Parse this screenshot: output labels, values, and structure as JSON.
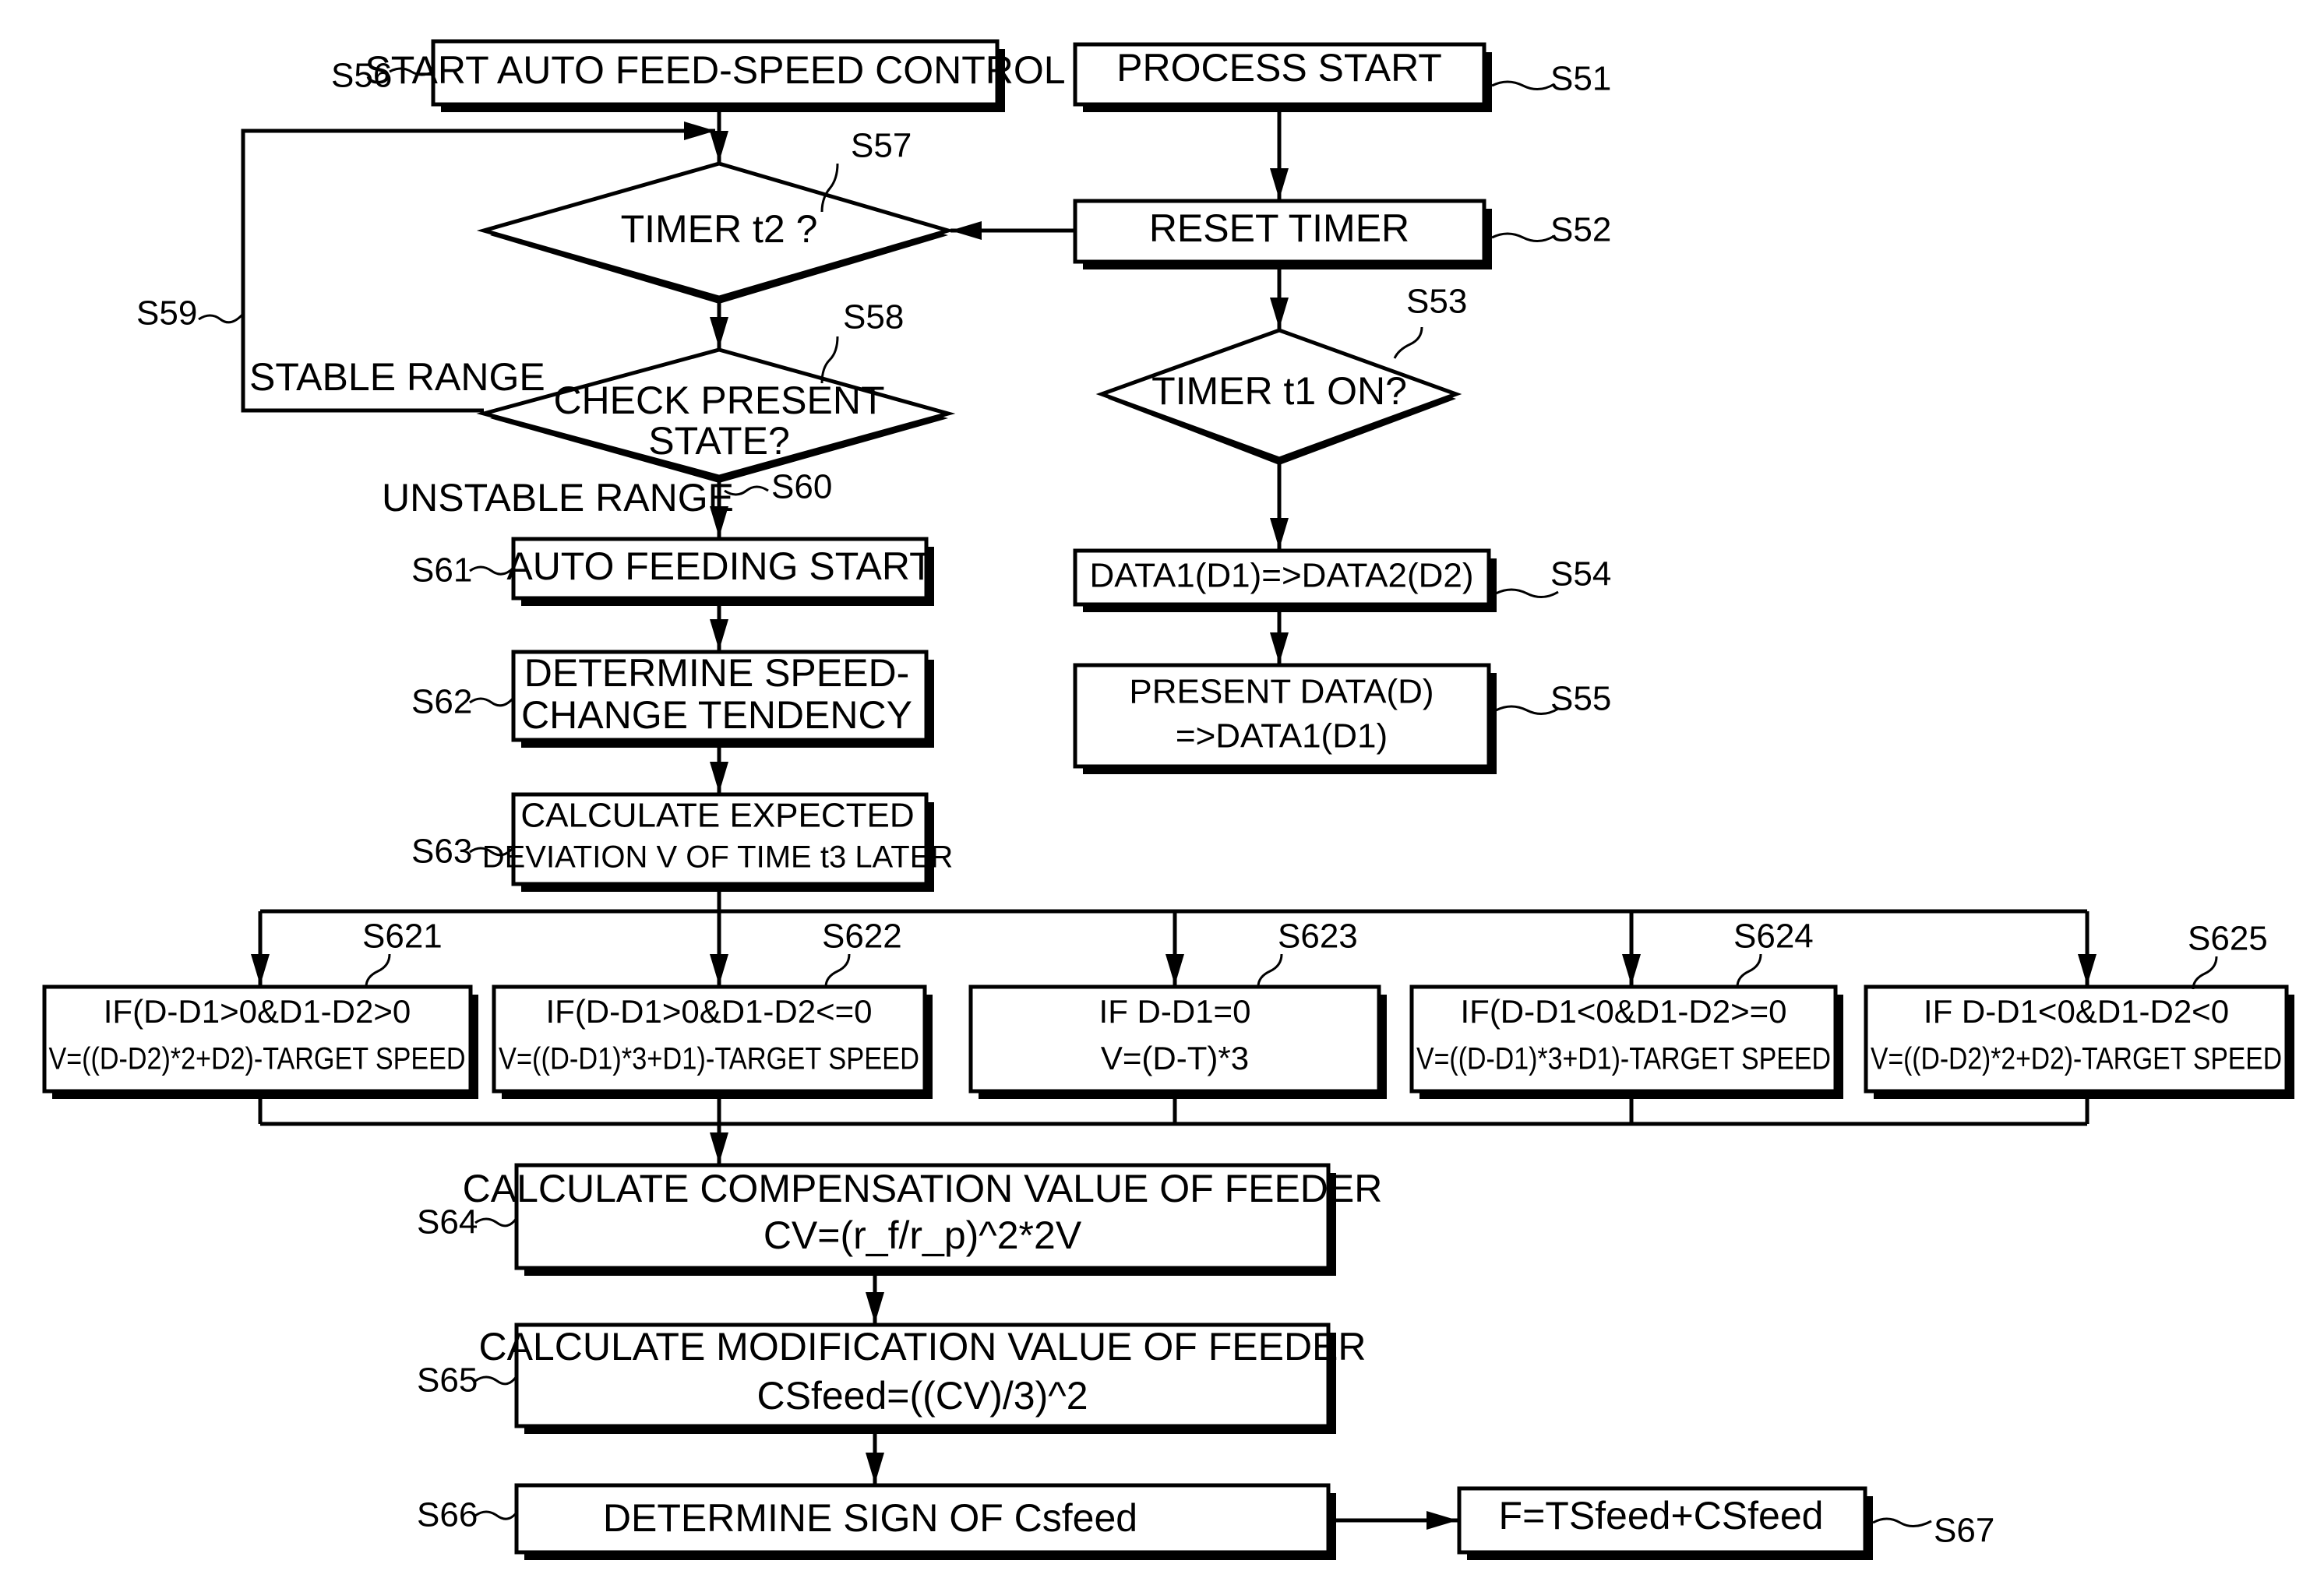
{
  "diagram": {
    "type": "flowchart",
    "left_flow": {
      "s56": {
        "id": "S56",
        "text": "START AUTO FEED-SPEED CONTROL"
      },
      "s57": {
        "id": "S57",
        "text": "TIMER t2 ?"
      },
      "s58": {
        "id": "S58",
        "line1": "CHECK PRESENT",
        "line2": "STATE?"
      },
      "s59": {
        "id": "S59",
        "label": "STABLE RANGE"
      },
      "s60": {
        "id": "S60",
        "label": "UNSTABLE RANGE"
      },
      "s61": {
        "id": "S61",
        "text": "AUTO FEEDING START"
      },
      "s62": {
        "id": "S62",
        "line1": "DETERMINE SPEED-",
        "line2": "CHANGE TENDENCY"
      },
      "s63": {
        "id": "S63",
        "line1": "CALCULATE EXPECTED",
        "line2": "DEVIATION V OF TIME t3 LATER"
      }
    },
    "right_flow": {
      "s51": {
        "id": "S51",
        "text": "PROCESS START"
      },
      "s52": {
        "id": "S52",
        "text": "RESET TIMER"
      },
      "s53": {
        "id": "S53",
        "text": "TIMER t1 ON?"
      },
      "s54": {
        "id": "S54",
        "text": "DATA1(D1)=>DATA2(D2)"
      },
      "s55": {
        "id": "S55",
        "line1": "PRESENT DATA(D)",
        "line2": "=>DATA1(D1)"
      }
    },
    "branches": [
      {
        "id": "S621",
        "line1": "IF(D-D1>0&D1-D2>0",
        "line2": "V=((D-D2)*2+D2)-TARGET SPEED"
      },
      {
        "id": "S622",
        "line1": "IF(D-D1>0&D1-D2<=0",
        "line2": "V=((D-D1)*3+D1)-TARGET SPEED"
      },
      {
        "id": "S623",
        "line1": "IF D-D1=0",
        "line2": "V=(D-T)*3"
      },
      {
        "id": "S624",
        "line1": "IF(D-D1<0&D1-D2>=0",
        "line2": "V=((D-D1)*3+D1)-TARGET SPEED"
      },
      {
        "id": "S625",
        "line1": "IF D-D1<0&D1-D2<0",
        "line2": "V=((D-D2)*2+D2)-TARGET SPEED"
      }
    ],
    "bottom_flow": {
      "s64": {
        "id": "S64",
        "line1": "CALCULATE COMPENSATION VALUE OF FEEDER",
        "line2": "CV=(r_f/r_p)^2*2V"
      },
      "s65": {
        "id": "S65",
        "line1": "CALCULATE MODIFICATION VALUE OF FEEDER",
        "line2": "CSfeed=((CV)/3)^2"
      },
      "s66": {
        "id": "S66",
        "text": "DETERMINE SIGN OF Csfeed"
      },
      "s67": {
        "id": "S67",
        "text": "F=TSfeed+CSfeed"
      }
    }
  }
}
